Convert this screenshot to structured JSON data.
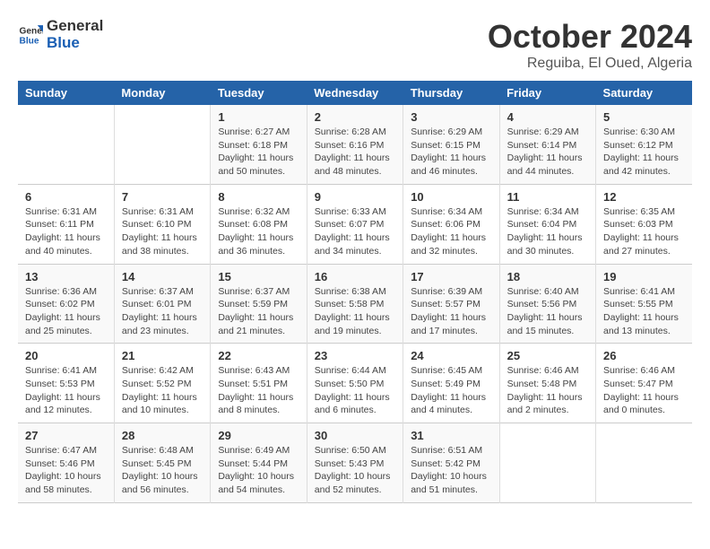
{
  "logo": {
    "line1": "General",
    "line2": "Blue"
  },
  "title": "October 2024",
  "subtitle": "Reguiba, El Oued, Algeria",
  "headers": [
    "Sunday",
    "Monday",
    "Tuesday",
    "Wednesday",
    "Thursday",
    "Friday",
    "Saturday"
  ],
  "weeks": [
    [
      {
        "day": "",
        "info": ""
      },
      {
        "day": "",
        "info": ""
      },
      {
        "day": "1",
        "info": "Sunrise: 6:27 AM\nSunset: 6:18 PM\nDaylight: 11 hours and 50 minutes."
      },
      {
        "day": "2",
        "info": "Sunrise: 6:28 AM\nSunset: 6:16 PM\nDaylight: 11 hours and 48 minutes."
      },
      {
        "day": "3",
        "info": "Sunrise: 6:29 AM\nSunset: 6:15 PM\nDaylight: 11 hours and 46 minutes."
      },
      {
        "day": "4",
        "info": "Sunrise: 6:29 AM\nSunset: 6:14 PM\nDaylight: 11 hours and 44 minutes."
      },
      {
        "day": "5",
        "info": "Sunrise: 6:30 AM\nSunset: 6:12 PM\nDaylight: 11 hours and 42 minutes."
      }
    ],
    [
      {
        "day": "6",
        "info": "Sunrise: 6:31 AM\nSunset: 6:11 PM\nDaylight: 11 hours and 40 minutes."
      },
      {
        "day": "7",
        "info": "Sunrise: 6:31 AM\nSunset: 6:10 PM\nDaylight: 11 hours and 38 minutes."
      },
      {
        "day": "8",
        "info": "Sunrise: 6:32 AM\nSunset: 6:08 PM\nDaylight: 11 hours and 36 minutes."
      },
      {
        "day": "9",
        "info": "Sunrise: 6:33 AM\nSunset: 6:07 PM\nDaylight: 11 hours and 34 minutes."
      },
      {
        "day": "10",
        "info": "Sunrise: 6:34 AM\nSunset: 6:06 PM\nDaylight: 11 hours and 32 minutes."
      },
      {
        "day": "11",
        "info": "Sunrise: 6:34 AM\nSunset: 6:04 PM\nDaylight: 11 hours and 30 minutes."
      },
      {
        "day": "12",
        "info": "Sunrise: 6:35 AM\nSunset: 6:03 PM\nDaylight: 11 hours and 27 minutes."
      }
    ],
    [
      {
        "day": "13",
        "info": "Sunrise: 6:36 AM\nSunset: 6:02 PM\nDaylight: 11 hours and 25 minutes."
      },
      {
        "day": "14",
        "info": "Sunrise: 6:37 AM\nSunset: 6:01 PM\nDaylight: 11 hours and 23 minutes."
      },
      {
        "day": "15",
        "info": "Sunrise: 6:37 AM\nSunset: 5:59 PM\nDaylight: 11 hours and 21 minutes."
      },
      {
        "day": "16",
        "info": "Sunrise: 6:38 AM\nSunset: 5:58 PM\nDaylight: 11 hours and 19 minutes."
      },
      {
        "day": "17",
        "info": "Sunrise: 6:39 AM\nSunset: 5:57 PM\nDaylight: 11 hours and 17 minutes."
      },
      {
        "day": "18",
        "info": "Sunrise: 6:40 AM\nSunset: 5:56 PM\nDaylight: 11 hours and 15 minutes."
      },
      {
        "day": "19",
        "info": "Sunrise: 6:41 AM\nSunset: 5:55 PM\nDaylight: 11 hours and 13 minutes."
      }
    ],
    [
      {
        "day": "20",
        "info": "Sunrise: 6:41 AM\nSunset: 5:53 PM\nDaylight: 11 hours and 12 minutes."
      },
      {
        "day": "21",
        "info": "Sunrise: 6:42 AM\nSunset: 5:52 PM\nDaylight: 11 hours and 10 minutes."
      },
      {
        "day": "22",
        "info": "Sunrise: 6:43 AM\nSunset: 5:51 PM\nDaylight: 11 hours and 8 minutes."
      },
      {
        "day": "23",
        "info": "Sunrise: 6:44 AM\nSunset: 5:50 PM\nDaylight: 11 hours and 6 minutes."
      },
      {
        "day": "24",
        "info": "Sunrise: 6:45 AM\nSunset: 5:49 PM\nDaylight: 11 hours and 4 minutes."
      },
      {
        "day": "25",
        "info": "Sunrise: 6:46 AM\nSunset: 5:48 PM\nDaylight: 11 hours and 2 minutes."
      },
      {
        "day": "26",
        "info": "Sunrise: 6:46 AM\nSunset: 5:47 PM\nDaylight: 11 hours and 0 minutes."
      }
    ],
    [
      {
        "day": "27",
        "info": "Sunrise: 6:47 AM\nSunset: 5:46 PM\nDaylight: 10 hours and 58 minutes."
      },
      {
        "day": "28",
        "info": "Sunrise: 6:48 AM\nSunset: 5:45 PM\nDaylight: 10 hours and 56 minutes."
      },
      {
        "day": "29",
        "info": "Sunrise: 6:49 AM\nSunset: 5:44 PM\nDaylight: 10 hours and 54 minutes."
      },
      {
        "day": "30",
        "info": "Sunrise: 6:50 AM\nSunset: 5:43 PM\nDaylight: 10 hours and 52 minutes."
      },
      {
        "day": "31",
        "info": "Sunrise: 6:51 AM\nSunset: 5:42 PM\nDaylight: 10 hours and 51 minutes."
      },
      {
        "day": "",
        "info": ""
      },
      {
        "day": "",
        "info": ""
      }
    ]
  ]
}
